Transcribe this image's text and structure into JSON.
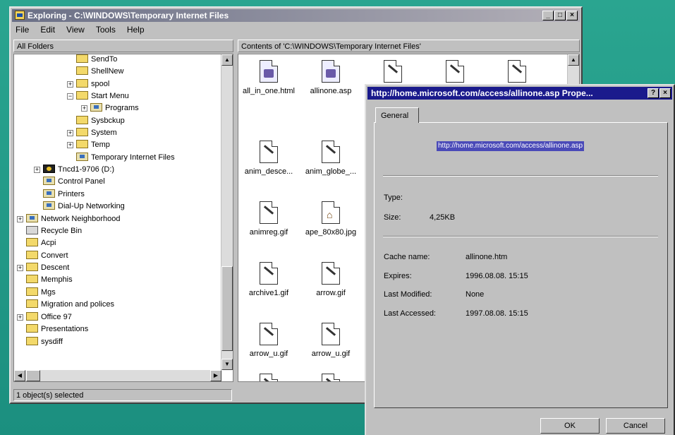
{
  "explorer": {
    "title": "Exploring - C:\\WINDOWS\\Temporary Internet Files",
    "menu": [
      "File",
      "Edit",
      "View",
      "Tools",
      "Help"
    ],
    "left_header": "All Folders",
    "right_header": "Contents of 'C:\\WINDOWS\\Temporary Internet Files'",
    "status": "1 object(s) selected"
  },
  "tree": [
    {
      "label": "SendTo"
    },
    {
      "label": "ShellNew"
    },
    {
      "label": "spool"
    },
    {
      "label": "Start Menu"
    },
    {
      "label": "Programs"
    },
    {
      "label": "Sysbckup"
    },
    {
      "label": "System"
    },
    {
      "label": "Temp"
    },
    {
      "label": "Temporary Internet Files"
    },
    {
      "label": "Tncd1-9706 (D:)"
    },
    {
      "label": "Control Panel"
    },
    {
      "label": "Printers"
    },
    {
      "label": "Dial-Up Networking"
    },
    {
      "label": "Network Neighborhood"
    },
    {
      "label": "Recycle Bin"
    },
    {
      "label": "Acpi"
    },
    {
      "label": "Convert"
    },
    {
      "label": "Descent"
    },
    {
      "label": "Memphis"
    },
    {
      "label": "Mgs"
    },
    {
      "label": "Migration and polices"
    },
    {
      "label": "Office 97"
    },
    {
      "label": "Presentations"
    },
    {
      "label": "sysdiff"
    }
  ],
  "files": [
    {
      "name": "all_in_one.html",
      "icon": "html-file-icon"
    },
    {
      "name": "allinone.asp",
      "icon": "html-file-icon"
    },
    {
      "name": "anim_desce...",
      "icon": "image-file-icon"
    },
    {
      "name": "anim_globe_...",
      "icon": "image-file-icon"
    },
    {
      "name": "animreg.gif",
      "icon": "image-file-icon"
    },
    {
      "name": "ape_80x80.jpg",
      "icon": "jpg-file-icon"
    },
    {
      "name": "archive1.gif",
      "icon": "image-file-icon"
    },
    {
      "name": "arrow.gif",
      "icon": "image-file-icon"
    },
    {
      "name": "arrow_u.gif",
      "icon": "image-file-icon"
    },
    {
      "name": "arrow_u.gif",
      "icon": "image-file-icon"
    }
  ],
  "dialog": {
    "title": "http://home.microsoft.com/access/allinone.asp Prope...",
    "tab": "General",
    "url": "http://home.microsoft.com/access/allinone.asp",
    "type_label": "Type:",
    "size_label": "Size:",
    "size_value": "4,25KB",
    "cache_label": "Cache name:",
    "cache_value": "allinone.htm",
    "expires_label": "Expires:",
    "expires_value": "1996.08.08. 15:15",
    "modified_label": "Last Modified:",
    "modified_value": "None",
    "accessed_label": "Last Accessed:",
    "accessed_value": "1997.08.08. 15:15",
    "ok": "OK",
    "cancel": "Cancel"
  }
}
